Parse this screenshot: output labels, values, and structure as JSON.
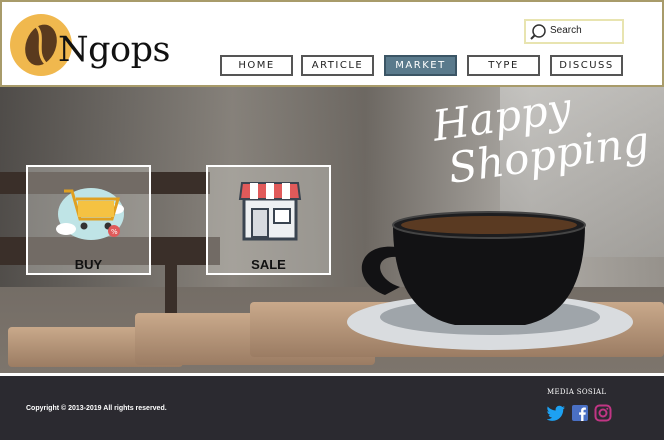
{
  "brand": {
    "name": "Ngops"
  },
  "search": {
    "label": "Search"
  },
  "nav": {
    "items": [
      "HOME",
      "ARTICLE",
      "MARKET",
      "TYPE",
      "DISCUSS"
    ],
    "active": "MARKET"
  },
  "hero": {
    "title_line1": "Happy",
    "title_line2": "Shopping",
    "cards": [
      {
        "label": "BUY",
        "icon": "shopping-cart-icon"
      },
      {
        "label": "SALE",
        "icon": "storefront-icon"
      }
    ]
  },
  "footer": {
    "copyright": "Copyright © 2013-2019  All rights reserved.",
    "social_title": "MEDIA SOSIAL",
    "social_icons": [
      "twitter-icon",
      "facebook-icon",
      "instagram-icon"
    ]
  },
  "colors": {
    "header_border": "#a89b6a",
    "logo": "#f0b84e",
    "nav_active": "#5a7a8c",
    "footer_bg": "#2b2a30",
    "twitter": "#1da1f2",
    "facebook": "#4a70c4",
    "instagram": "#c13584"
  }
}
